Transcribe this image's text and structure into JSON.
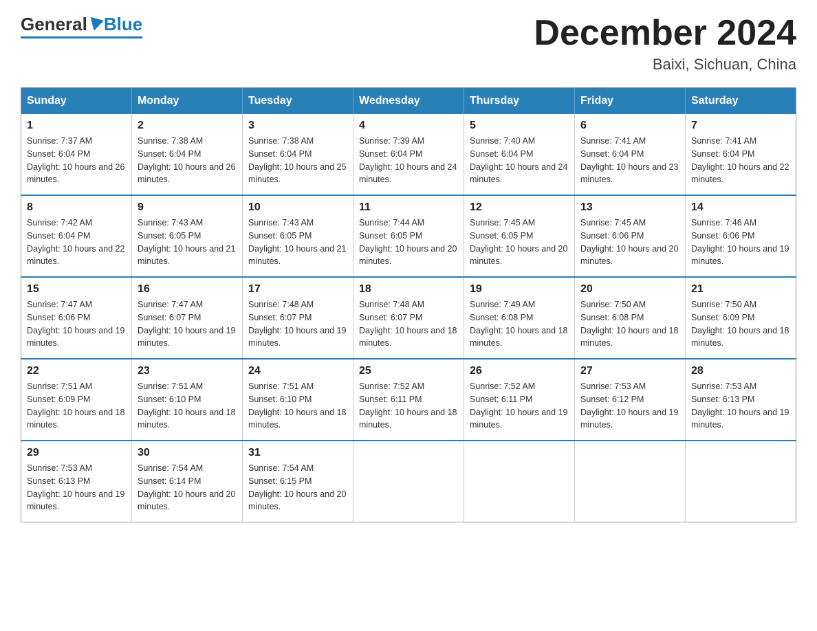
{
  "header": {
    "logo": {
      "general": "General",
      "blue": "Blue"
    },
    "title": "December 2024",
    "location": "Baixi, Sichuan, China"
  },
  "weekdays": [
    "Sunday",
    "Monday",
    "Tuesday",
    "Wednesday",
    "Thursday",
    "Friday",
    "Saturday"
  ],
  "weeks": [
    [
      {
        "day": "1",
        "sunrise": "7:37 AM",
        "sunset": "6:04 PM",
        "daylight": "10 hours and 26 minutes."
      },
      {
        "day": "2",
        "sunrise": "7:38 AM",
        "sunset": "6:04 PM",
        "daylight": "10 hours and 26 minutes."
      },
      {
        "day": "3",
        "sunrise": "7:38 AM",
        "sunset": "6:04 PM",
        "daylight": "10 hours and 25 minutes."
      },
      {
        "day": "4",
        "sunrise": "7:39 AM",
        "sunset": "6:04 PM",
        "daylight": "10 hours and 24 minutes."
      },
      {
        "day": "5",
        "sunrise": "7:40 AM",
        "sunset": "6:04 PM",
        "daylight": "10 hours and 24 minutes."
      },
      {
        "day": "6",
        "sunrise": "7:41 AM",
        "sunset": "6:04 PM",
        "daylight": "10 hours and 23 minutes."
      },
      {
        "day": "7",
        "sunrise": "7:41 AM",
        "sunset": "6:04 PM",
        "daylight": "10 hours and 22 minutes."
      }
    ],
    [
      {
        "day": "8",
        "sunrise": "7:42 AM",
        "sunset": "6:04 PM",
        "daylight": "10 hours and 22 minutes."
      },
      {
        "day": "9",
        "sunrise": "7:43 AM",
        "sunset": "6:05 PM",
        "daylight": "10 hours and 21 minutes."
      },
      {
        "day": "10",
        "sunrise": "7:43 AM",
        "sunset": "6:05 PM",
        "daylight": "10 hours and 21 minutes."
      },
      {
        "day": "11",
        "sunrise": "7:44 AM",
        "sunset": "6:05 PM",
        "daylight": "10 hours and 20 minutes."
      },
      {
        "day": "12",
        "sunrise": "7:45 AM",
        "sunset": "6:05 PM",
        "daylight": "10 hours and 20 minutes."
      },
      {
        "day": "13",
        "sunrise": "7:45 AM",
        "sunset": "6:06 PM",
        "daylight": "10 hours and 20 minutes."
      },
      {
        "day": "14",
        "sunrise": "7:46 AM",
        "sunset": "6:06 PM",
        "daylight": "10 hours and 19 minutes."
      }
    ],
    [
      {
        "day": "15",
        "sunrise": "7:47 AM",
        "sunset": "6:06 PM",
        "daylight": "10 hours and 19 minutes."
      },
      {
        "day": "16",
        "sunrise": "7:47 AM",
        "sunset": "6:07 PM",
        "daylight": "10 hours and 19 minutes."
      },
      {
        "day": "17",
        "sunrise": "7:48 AM",
        "sunset": "6:07 PM",
        "daylight": "10 hours and 19 minutes."
      },
      {
        "day": "18",
        "sunrise": "7:48 AM",
        "sunset": "6:07 PM",
        "daylight": "10 hours and 18 minutes."
      },
      {
        "day": "19",
        "sunrise": "7:49 AM",
        "sunset": "6:08 PM",
        "daylight": "10 hours and 18 minutes."
      },
      {
        "day": "20",
        "sunrise": "7:50 AM",
        "sunset": "6:08 PM",
        "daylight": "10 hours and 18 minutes."
      },
      {
        "day": "21",
        "sunrise": "7:50 AM",
        "sunset": "6:09 PM",
        "daylight": "10 hours and 18 minutes."
      }
    ],
    [
      {
        "day": "22",
        "sunrise": "7:51 AM",
        "sunset": "6:09 PM",
        "daylight": "10 hours and 18 minutes."
      },
      {
        "day": "23",
        "sunrise": "7:51 AM",
        "sunset": "6:10 PM",
        "daylight": "10 hours and 18 minutes."
      },
      {
        "day": "24",
        "sunrise": "7:51 AM",
        "sunset": "6:10 PM",
        "daylight": "10 hours and 18 minutes."
      },
      {
        "day": "25",
        "sunrise": "7:52 AM",
        "sunset": "6:11 PM",
        "daylight": "10 hours and 18 minutes."
      },
      {
        "day": "26",
        "sunrise": "7:52 AM",
        "sunset": "6:11 PM",
        "daylight": "10 hours and 19 minutes."
      },
      {
        "day": "27",
        "sunrise": "7:53 AM",
        "sunset": "6:12 PM",
        "daylight": "10 hours and 19 minutes."
      },
      {
        "day": "28",
        "sunrise": "7:53 AM",
        "sunset": "6:13 PM",
        "daylight": "10 hours and 19 minutes."
      }
    ],
    [
      {
        "day": "29",
        "sunrise": "7:53 AM",
        "sunset": "6:13 PM",
        "daylight": "10 hours and 19 minutes."
      },
      {
        "day": "30",
        "sunrise": "7:54 AM",
        "sunset": "6:14 PM",
        "daylight": "10 hours and 20 minutes."
      },
      {
        "day": "31",
        "sunrise": "7:54 AM",
        "sunset": "6:15 PM",
        "daylight": "10 hours and 20 minutes."
      },
      null,
      null,
      null,
      null
    ]
  ]
}
